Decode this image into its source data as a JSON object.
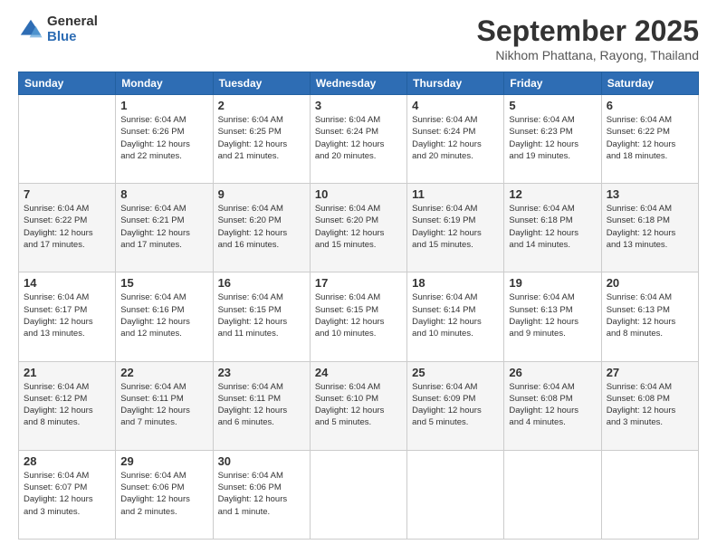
{
  "logo": {
    "general": "General",
    "blue": "Blue"
  },
  "header": {
    "title": "September 2025",
    "location": "Nikhom Phattana, Rayong, Thailand"
  },
  "weekdays": [
    "Sunday",
    "Monday",
    "Tuesday",
    "Wednesday",
    "Thursday",
    "Friday",
    "Saturday"
  ],
  "weeks": [
    [
      {
        "day": "",
        "info": ""
      },
      {
        "day": "1",
        "info": "Sunrise: 6:04 AM\nSunset: 6:26 PM\nDaylight: 12 hours\nand 22 minutes."
      },
      {
        "day": "2",
        "info": "Sunrise: 6:04 AM\nSunset: 6:25 PM\nDaylight: 12 hours\nand 21 minutes."
      },
      {
        "day": "3",
        "info": "Sunrise: 6:04 AM\nSunset: 6:24 PM\nDaylight: 12 hours\nand 20 minutes."
      },
      {
        "day": "4",
        "info": "Sunrise: 6:04 AM\nSunset: 6:24 PM\nDaylight: 12 hours\nand 20 minutes."
      },
      {
        "day": "5",
        "info": "Sunrise: 6:04 AM\nSunset: 6:23 PM\nDaylight: 12 hours\nand 19 minutes."
      },
      {
        "day": "6",
        "info": "Sunrise: 6:04 AM\nSunset: 6:22 PM\nDaylight: 12 hours\nand 18 minutes."
      }
    ],
    [
      {
        "day": "7",
        "info": "Sunrise: 6:04 AM\nSunset: 6:22 PM\nDaylight: 12 hours\nand 17 minutes."
      },
      {
        "day": "8",
        "info": "Sunrise: 6:04 AM\nSunset: 6:21 PM\nDaylight: 12 hours\nand 17 minutes."
      },
      {
        "day": "9",
        "info": "Sunrise: 6:04 AM\nSunset: 6:20 PM\nDaylight: 12 hours\nand 16 minutes."
      },
      {
        "day": "10",
        "info": "Sunrise: 6:04 AM\nSunset: 6:20 PM\nDaylight: 12 hours\nand 15 minutes."
      },
      {
        "day": "11",
        "info": "Sunrise: 6:04 AM\nSunset: 6:19 PM\nDaylight: 12 hours\nand 15 minutes."
      },
      {
        "day": "12",
        "info": "Sunrise: 6:04 AM\nSunset: 6:18 PM\nDaylight: 12 hours\nand 14 minutes."
      },
      {
        "day": "13",
        "info": "Sunrise: 6:04 AM\nSunset: 6:18 PM\nDaylight: 12 hours\nand 13 minutes."
      }
    ],
    [
      {
        "day": "14",
        "info": "Sunrise: 6:04 AM\nSunset: 6:17 PM\nDaylight: 12 hours\nand 13 minutes."
      },
      {
        "day": "15",
        "info": "Sunrise: 6:04 AM\nSunset: 6:16 PM\nDaylight: 12 hours\nand 12 minutes."
      },
      {
        "day": "16",
        "info": "Sunrise: 6:04 AM\nSunset: 6:15 PM\nDaylight: 12 hours\nand 11 minutes."
      },
      {
        "day": "17",
        "info": "Sunrise: 6:04 AM\nSunset: 6:15 PM\nDaylight: 12 hours\nand 10 minutes."
      },
      {
        "day": "18",
        "info": "Sunrise: 6:04 AM\nSunset: 6:14 PM\nDaylight: 12 hours\nand 10 minutes."
      },
      {
        "day": "19",
        "info": "Sunrise: 6:04 AM\nSunset: 6:13 PM\nDaylight: 12 hours\nand 9 minutes."
      },
      {
        "day": "20",
        "info": "Sunrise: 6:04 AM\nSunset: 6:13 PM\nDaylight: 12 hours\nand 8 minutes."
      }
    ],
    [
      {
        "day": "21",
        "info": "Sunrise: 6:04 AM\nSunset: 6:12 PM\nDaylight: 12 hours\nand 8 minutes."
      },
      {
        "day": "22",
        "info": "Sunrise: 6:04 AM\nSunset: 6:11 PM\nDaylight: 12 hours\nand 7 minutes."
      },
      {
        "day": "23",
        "info": "Sunrise: 6:04 AM\nSunset: 6:11 PM\nDaylight: 12 hours\nand 6 minutes."
      },
      {
        "day": "24",
        "info": "Sunrise: 6:04 AM\nSunset: 6:10 PM\nDaylight: 12 hours\nand 5 minutes."
      },
      {
        "day": "25",
        "info": "Sunrise: 6:04 AM\nSunset: 6:09 PM\nDaylight: 12 hours\nand 5 minutes."
      },
      {
        "day": "26",
        "info": "Sunrise: 6:04 AM\nSunset: 6:08 PM\nDaylight: 12 hours\nand 4 minutes."
      },
      {
        "day": "27",
        "info": "Sunrise: 6:04 AM\nSunset: 6:08 PM\nDaylight: 12 hours\nand 3 minutes."
      }
    ],
    [
      {
        "day": "28",
        "info": "Sunrise: 6:04 AM\nSunset: 6:07 PM\nDaylight: 12 hours\nand 3 minutes."
      },
      {
        "day": "29",
        "info": "Sunrise: 6:04 AM\nSunset: 6:06 PM\nDaylight: 12 hours\nand 2 minutes."
      },
      {
        "day": "30",
        "info": "Sunrise: 6:04 AM\nSunset: 6:06 PM\nDaylight: 12 hours\nand 1 minute."
      },
      {
        "day": "",
        "info": ""
      },
      {
        "day": "",
        "info": ""
      },
      {
        "day": "",
        "info": ""
      },
      {
        "day": "",
        "info": ""
      }
    ]
  ]
}
